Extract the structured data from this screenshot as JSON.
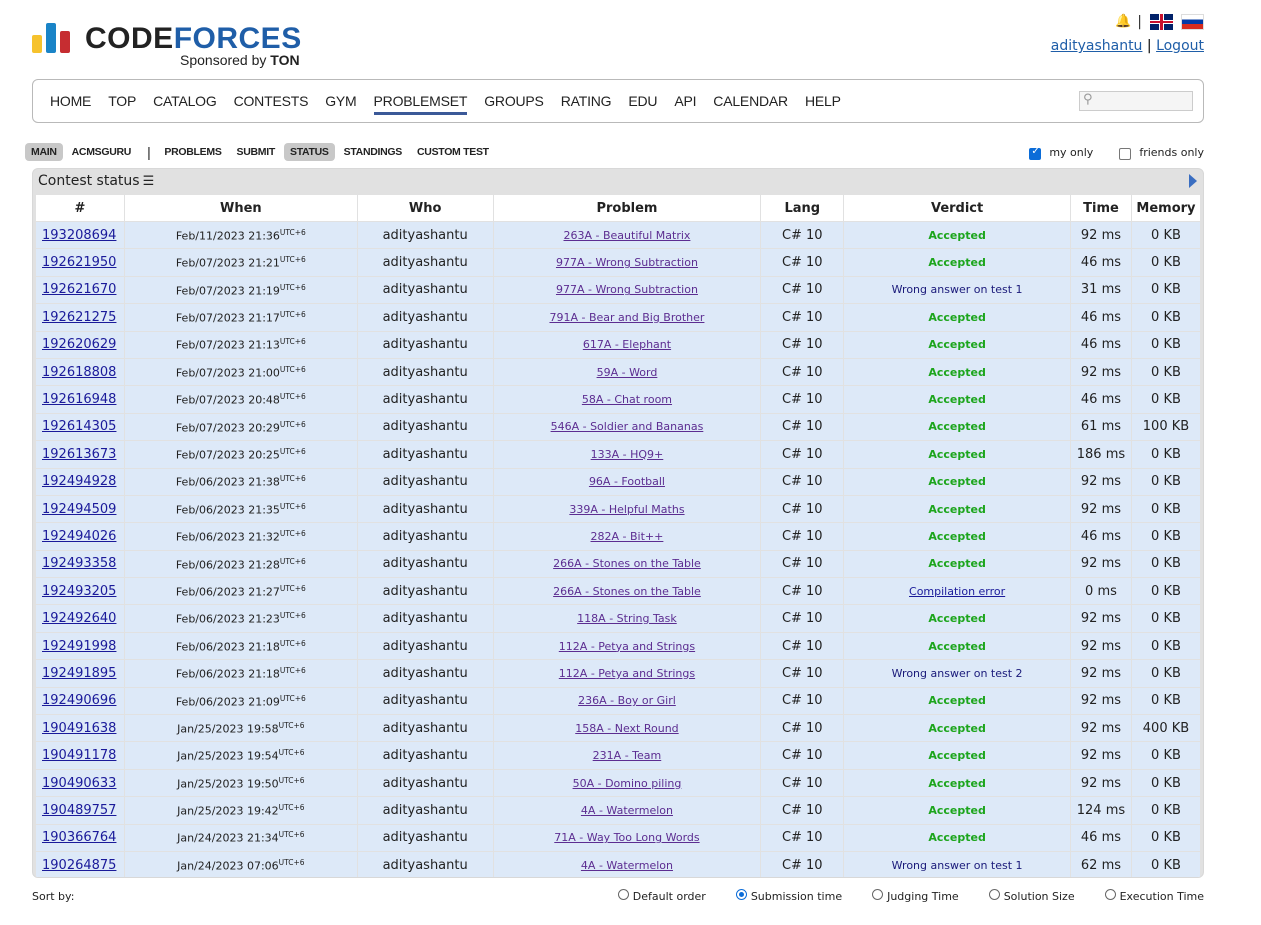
{
  "header": {
    "logo_code": "CODE",
    "logo_forces": "FORCES",
    "sponsor_prefix": "Sponsored by",
    "sponsor_name": "TON",
    "username": "adityashantu",
    "logout": "Logout",
    "separator": "|"
  },
  "nav": [
    "HOME",
    "TOP",
    "CATALOG",
    "CONTESTS",
    "GYM",
    "PROBLEMSET",
    "GROUPS",
    "RATING",
    "EDU",
    "API",
    "CALENDAR",
    "HELP"
  ],
  "nav_active": "PROBLEMSET",
  "submenu": {
    "left": [
      {
        "label": "MAIN",
        "selected": true
      },
      {
        "label": "ACMSGURU",
        "selected": false
      }
    ],
    "right": [
      {
        "label": "PROBLEMS",
        "selected": false
      },
      {
        "label": "SUBMIT",
        "selected": false
      },
      {
        "label": "STATUS",
        "selected": true
      },
      {
        "label": "STANDINGS",
        "selected": false
      },
      {
        "label": "CUSTOM TEST",
        "selected": false
      }
    ],
    "my_only": "my only",
    "my_only_checked": true,
    "friends_only": "friends only",
    "friends_only_checked": false
  },
  "table": {
    "caption": "Contest status",
    "headers": [
      "#",
      "When",
      "Who",
      "Problem",
      "Lang",
      "Verdict",
      "Time",
      "Memory"
    ],
    "tz": "UTC+6",
    "rows": [
      [
        "193208694",
        "Feb/11/2023 21:36",
        "adityashantu",
        "263A - Beautiful Matrix",
        "C# 10",
        "Accepted",
        "92 ms",
        "0 KB"
      ],
      [
        "192621950",
        "Feb/07/2023 21:21",
        "adityashantu",
        "977A - Wrong Subtraction",
        "C# 10",
        "Accepted",
        "46 ms",
        "0 KB"
      ],
      [
        "192621670",
        "Feb/07/2023 21:19",
        "adityashantu",
        "977A - Wrong Subtraction",
        "C# 10",
        "Wrong answer on test 1",
        "31 ms",
        "0 KB"
      ],
      [
        "192621275",
        "Feb/07/2023 21:17",
        "adityashantu",
        "791A - Bear and Big Brother",
        "C# 10",
        "Accepted",
        "46 ms",
        "0 KB"
      ],
      [
        "192620629",
        "Feb/07/2023 21:13",
        "adityashantu",
        "617A - Elephant",
        "C# 10",
        "Accepted",
        "46 ms",
        "0 KB"
      ],
      [
        "192618808",
        "Feb/07/2023 21:00",
        "adityashantu",
        "59A - Word",
        "C# 10",
        "Accepted",
        "92 ms",
        "0 KB"
      ],
      [
        "192616948",
        "Feb/07/2023 20:48",
        "adityashantu",
        "58A - Chat room",
        "C# 10",
        "Accepted",
        "46 ms",
        "0 KB"
      ],
      [
        "192614305",
        "Feb/07/2023 20:29",
        "adityashantu",
        "546A - Soldier and Bananas",
        "C# 10",
        "Accepted",
        "61 ms",
        "100 KB"
      ],
      [
        "192613673",
        "Feb/07/2023 20:25",
        "adityashantu",
        "133A - HQ9+",
        "C# 10",
        "Accepted",
        "186 ms",
        "0 KB"
      ],
      [
        "192494928",
        "Feb/06/2023 21:38",
        "adityashantu",
        "96A - Football",
        "C# 10",
        "Accepted",
        "92 ms",
        "0 KB"
      ],
      [
        "192494509",
        "Feb/06/2023 21:35",
        "adityashantu",
        "339A - Helpful Maths",
        "C# 10",
        "Accepted",
        "92 ms",
        "0 KB"
      ],
      [
        "192494026",
        "Feb/06/2023 21:32",
        "adityashantu",
        "282A - Bit++",
        "C# 10",
        "Accepted",
        "46 ms",
        "0 KB"
      ],
      [
        "192493358",
        "Feb/06/2023 21:28",
        "adityashantu",
        "266A - Stones on the Table",
        "C# 10",
        "Accepted",
        "92 ms",
        "0 KB"
      ],
      [
        "192493205",
        "Feb/06/2023 21:27",
        "adityashantu",
        "266A - Stones on the Table",
        "C# 10",
        "Compilation error",
        "0 ms",
        "0 KB"
      ],
      [
        "192492640",
        "Feb/06/2023 21:23",
        "adityashantu",
        "118A - String Task",
        "C# 10",
        "Accepted",
        "92 ms",
        "0 KB"
      ],
      [
        "192491998",
        "Feb/06/2023 21:18",
        "adityashantu",
        "112A - Petya and Strings",
        "C# 10",
        "Accepted",
        "92 ms",
        "0 KB"
      ],
      [
        "192491895",
        "Feb/06/2023 21:18",
        "adityashantu",
        "112A - Petya and Strings",
        "C# 10",
        "Wrong answer on test 2",
        "92 ms",
        "0 KB"
      ],
      [
        "192490696",
        "Feb/06/2023 21:09",
        "adityashantu",
        "236A - Boy or Girl",
        "C# 10",
        "Accepted",
        "92 ms",
        "0 KB"
      ],
      [
        "190491638",
        "Jan/25/2023 19:58",
        "adityashantu",
        "158A - Next Round",
        "C# 10",
        "Accepted",
        "92 ms",
        "400 KB"
      ],
      [
        "190491178",
        "Jan/25/2023 19:54",
        "adityashantu",
        "231A - Team",
        "C# 10",
        "Accepted",
        "92 ms",
        "0 KB"
      ],
      [
        "190490633",
        "Jan/25/2023 19:50",
        "adityashantu",
        "50A - Domino piling",
        "C# 10",
        "Accepted",
        "92 ms",
        "0 KB"
      ],
      [
        "190489757",
        "Jan/25/2023 19:42",
        "adityashantu",
        "4A - Watermelon",
        "C# 10",
        "Accepted",
        "124 ms",
        "0 KB"
      ],
      [
        "190366764",
        "Jan/24/2023 21:34",
        "adityashantu",
        "71A - Way Too Long Words",
        "C# 10",
        "Accepted",
        "46 ms",
        "0 KB"
      ],
      [
        "190264875",
        "Jan/24/2023 07:06",
        "adityashantu",
        "4A - Watermelon",
        "C# 10",
        "Wrong answer on test 1",
        "62 ms",
        "0 KB"
      ]
    ]
  },
  "sort": {
    "label": "Sort by:",
    "options": [
      {
        "label": "Default order",
        "checked": false
      },
      {
        "label": "Submission time",
        "checked": true
      },
      {
        "label": "Judging Time",
        "checked": false
      },
      {
        "label": "Solution Size",
        "checked": false
      },
      {
        "label": "Execution Time",
        "checked": false
      }
    ]
  },
  "colors": {
    "accepted": "#1ca51c",
    "row_bg": "#dde9f8",
    "logo_blue": "#1f5ea8",
    "logo_yellow": "#f6c22d",
    "logo_red": "#c62d31",
    "logo_bar_blue": "#1a84c7"
  }
}
